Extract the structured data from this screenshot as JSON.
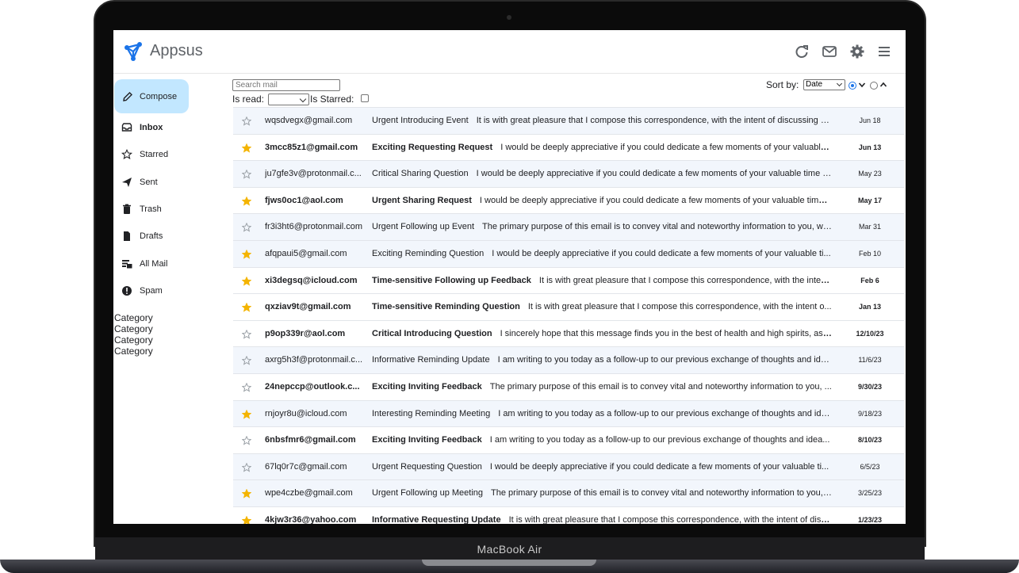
{
  "device": {
    "label": "MacBook Air"
  },
  "app": {
    "name": "Appsus"
  },
  "header": {
    "icons": [
      "refresh-icon",
      "mail-icon",
      "settings-icon",
      "menu-icon"
    ]
  },
  "sidebar": {
    "compose_label": "Compose",
    "items": [
      {
        "label": "Inbox",
        "icon": "inbox-icon"
      },
      {
        "label": "Starred",
        "icon": "star-icon"
      },
      {
        "label": "Sent",
        "icon": "send-icon"
      },
      {
        "label": "Trash",
        "icon": "trash-icon"
      },
      {
        "label": "Drafts",
        "icon": "draft-icon"
      },
      {
        "label": "All Mail",
        "icon": "all-mail-icon"
      },
      {
        "label": "Spam",
        "icon": "spam-icon"
      }
    ],
    "categories": [
      "Category",
      "Category",
      "Category",
      "Category"
    ]
  },
  "filters": {
    "search_placeholder": "Search mail",
    "is_read_label": "Is read:",
    "is_read_value": "",
    "is_starred_label": "Is Starred:",
    "is_starred_checked": false,
    "sort_label": "Sort by:",
    "sort_value": "Date",
    "sort_direction": "descending"
  },
  "colors": {
    "accent": "#1a73e8",
    "compose_bg": "#c2e7ff",
    "star_filled": "#f4b400",
    "read_row_bg": "#f2f6fc"
  },
  "emails": [
    {
      "starred": false,
      "read": true,
      "sender": "wqsdvegx@gmail.com",
      "subject": "Urgent Introducing Event",
      "body": "It is with great pleasure that I compose this correspondence, with the intent of discussing a...",
      "date": "Jun 18"
    },
    {
      "starred": true,
      "read": false,
      "sender": "3mcc85z1@gmail.com",
      "subject": "Exciting Requesting Request",
      "body": "I would be deeply appreciative if you could dedicate a few moments of your valuable...",
      "date": "Jun 13"
    },
    {
      "starred": false,
      "read": true,
      "sender": "ju7gfe3v@protonmail.c...",
      "subject": "Critical Sharing Question",
      "body": "I would be deeply appreciative if you could dedicate a few moments of your valuable time t...",
      "date": "May 23"
    },
    {
      "starred": true,
      "read": false,
      "sender": "fjws0oc1@aol.com",
      "subject": "Urgent Sharing Request",
      "body": "I would be deeply appreciative if you could dedicate a few moments of your valuable time ...",
      "date": "May 17"
    },
    {
      "starred": false,
      "read": true,
      "sender": "fr3i3ht6@protonmail.com",
      "subject": "Urgent Following up Event",
      "body": "The primary purpose of this email is to convey vital and noteworthy information to you, wi...",
      "date": "Mar 31"
    },
    {
      "starred": true,
      "read": true,
      "sender": "afqpaui5@gmail.com",
      "subject": "Exciting Reminding Question",
      "body": "I would be deeply appreciative if you could dedicate a few moments of your valuable ti...",
      "date": "Feb 10"
    },
    {
      "starred": true,
      "read": false,
      "sender": "xi3degsq@icloud.com",
      "subject": "Time-sensitive Following up Feedback",
      "body": "It is with great pleasure that I compose this correspondence, with the inten...",
      "date": "Feb 6"
    },
    {
      "starred": true,
      "read": false,
      "sender": "qxziav9t@gmail.com",
      "subject": "Time-sensitive Reminding Question",
      "body": "It is with great pleasure that I compose this correspondence, with the intent o...",
      "date": "Jan 13"
    },
    {
      "starred": false,
      "read": false,
      "sender": "p9op339r@aol.com",
      "subject": "Critical Introducing Question",
      "body": "I sincerely hope that this message finds you in the best of health and high spirits, as ...",
      "date": "12/10/23"
    },
    {
      "starred": false,
      "read": true,
      "sender": "axrg5h3f@protonmail.c...",
      "subject": "Informative Reminding Update",
      "body": "I am writing to you today as a follow-up to our previous exchange of thoughts and ide...",
      "date": "11/6/23"
    },
    {
      "starred": false,
      "read": false,
      "sender": "24nepccp@outlook.c...",
      "subject": "Exciting Inviting Feedback",
      "body": "The primary purpose of this email is to convey vital and noteworthy information to you, ...",
      "date": "9/30/23"
    },
    {
      "starred": true,
      "read": true,
      "sender": "rnjoyr8u@icloud.com",
      "subject": "Interesting Reminding Meeting",
      "body": "I am writing to you today as a follow-up to our previous exchange of thoughts and ide...",
      "date": "9/18/23"
    },
    {
      "starred": false,
      "read": false,
      "sender": "6nbsfmr6@gmail.com",
      "subject": "Exciting Inviting Feedback",
      "body": "I am writing to you today as a follow-up to our previous exchange of thoughts and idea...",
      "date": "8/10/23"
    },
    {
      "starred": false,
      "read": true,
      "sender": "67lq0r7c@gmail.com",
      "subject": "Urgent Requesting Question",
      "body": "I would be deeply appreciative if you could dedicate a few moments of your valuable ti...",
      "date": "6/5/23"
    },
    {
      "starred": true,
      "read": true,
      "sender": "wpe4czbe@gmail.com",
      "subject": "Urgent Following up Meeting",
      "body": "The primary purpose of this email is to convey vital and noteworthy information to you, ...",
      "date": "3/25/23"
    },
    {
      "starred": true,
      "read": false,
      "sender": "4kjw3r36@yahoo.com",
      "subject": "Informative Requesting Update",
      "body": "It is with great pleasure that I compose this correspondence, with the intent of disc...",
      "date": "1/23/23"
    }
  ]
}
